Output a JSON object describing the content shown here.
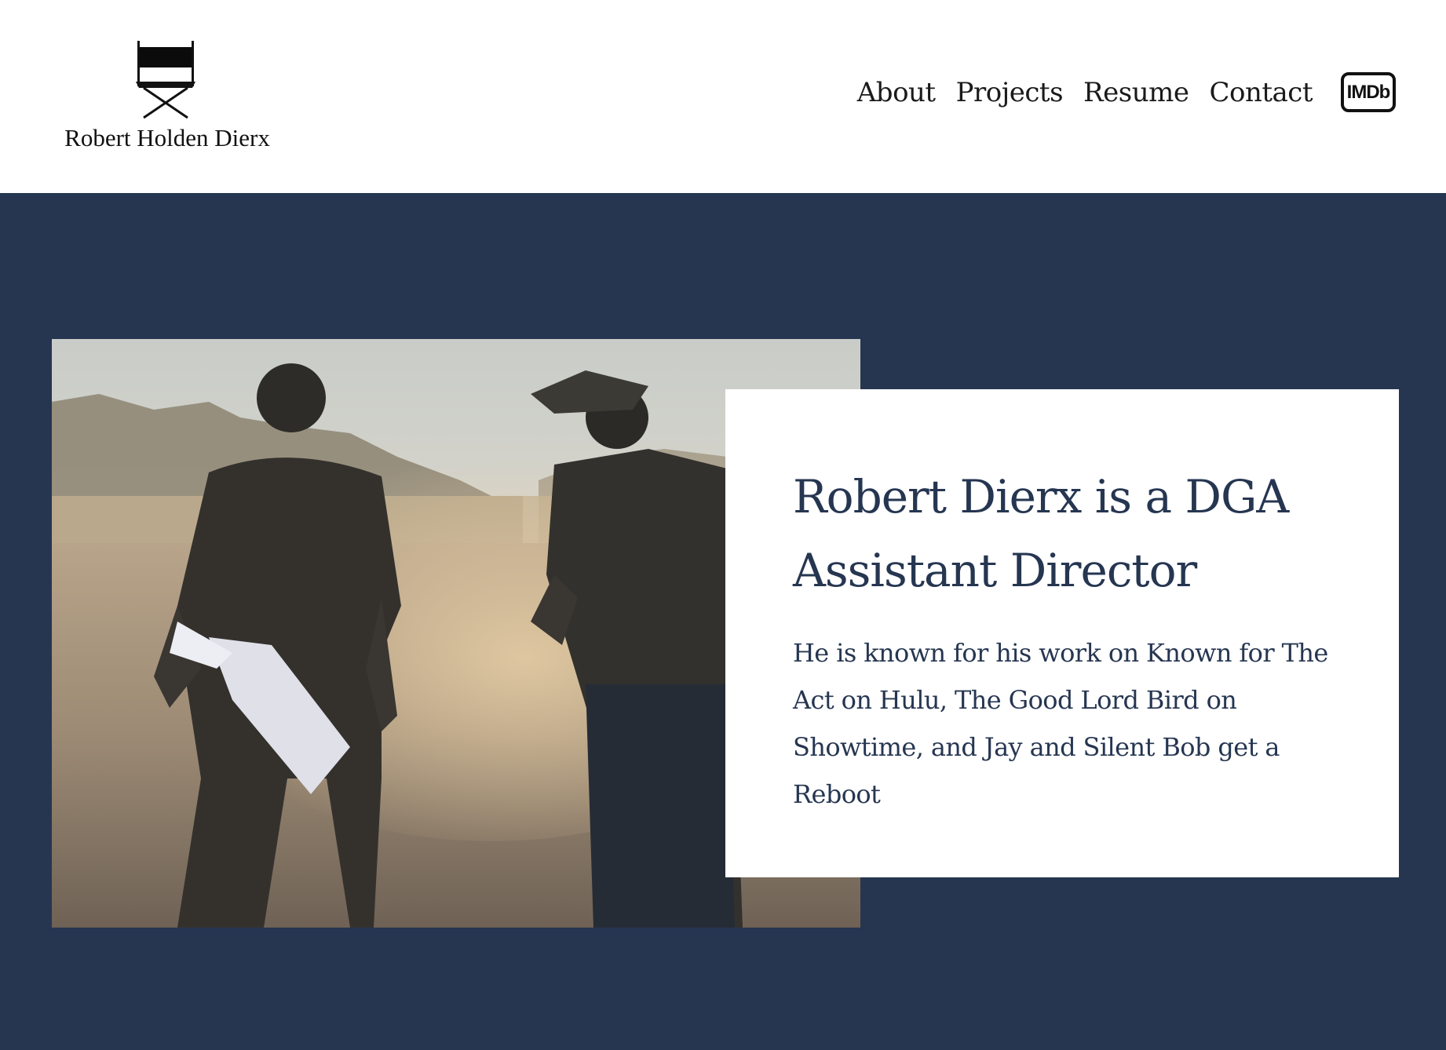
{
  "header": {
    "logo_text": "Robert Holden Dierx",
    "nav": [
      {
        "label": "About"
      },
      {
        "label": "Projects"
      },
      {
        "label": "Resume"
      },
      {
        "label": "Contact"
      }
    ],
    "imdb_label": "IMDb"
  },
  "hero": {
    "title": "Robert Dierx is a DGA Assistant Director",
    "body": "He is known for his work on Known for The Act on Hulu, The Good Lord Bird on Showtime, and Jay and Silent Bob get a Reboot"
  },
  "colors": {
    "hero_background": "#263651",
    "text_navy": "#263651",
    "header_background": "#ffffff"
  },
  "icons": {
    "logo": "directors-chair-icon",
    "imdb": "imdb-icon"
  }
}
